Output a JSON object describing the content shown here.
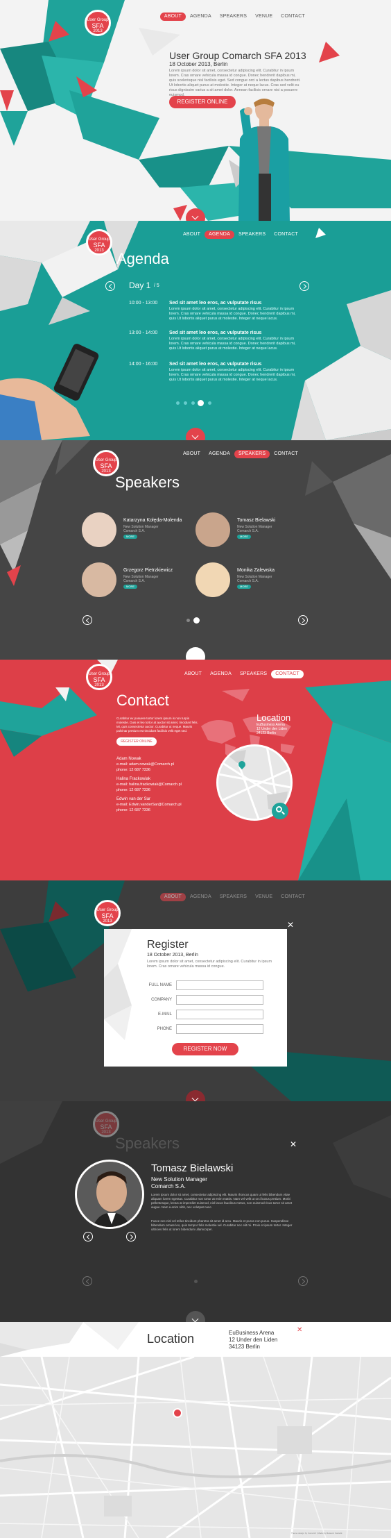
{
  "colors": {
    "red": "#e3434b",
    "teal": "#1fa39a",
    "dark": "#444444"
  },
  "logo": {
    "line1": "User Group",
    "line2": "SFA",
    "line3": "2013"
  },
  "hero": {
    "nav": [
      "ABOUT",
      "AGENDA",
      "SPEAKERS",
      "VENUE",
      "CONTACT"
    ],
    "title": "User Group Comarch SFA 2013",
    "subtitle": "18 October 2013, Berlin",
    "body": "Lorem ipsum dolor sit amet, consectetur adipiscing elit. Curabitur in ipsum lorem. Cras ornare vehicula massa id congue. Donec hendrerit dapibus mi, quis scelerisque nisl facilisis eget. Sed congue orci a lectus dapibus hendrerit. Ut lobortis aliquet purus at molestie. Integer at neque lacus. Cras sed velit eu risus dignissim varius a sit amet dolor. Aenean facilisis ornare nisi a posuere euismod.",
    "cta": "REGISTER ONLINE"
  },
  "agenda": {
    "nav": [
      "ABOUT",
      "AGENDA",
      "SPEAKERS",
      "CONTACT"
    ],
    "heading": "Agenda",
    "day": "Day 1",
    "day_total": "/ 5",
    "items": [
      {
        "time": "10:00 - 13:00",
        "title": "Sed sit amet leo eros, ac vulputate risus",
        "text": "Lorem ipsum dolor sit amet, consectetur adipiscing elit. Curabitur in ipsum lorem. Cras ornare vehicula massa id congue. Donec hendrerit dapibus mi, quis Ut lobortis aliquet purus at molestie. Integer at neque lacus."
      },
      {
        "time": "13:00 - 14:00",
        "title": "Sed sit amet leo eros, ac vulputate risus",
        "text": "Lorem ipsum dolor sit amet, consectetur adipiscing elit. Curabitur in ipsum lorem. Cras ornare vehicula massa id congue. Donec hendrerit dapibus mi, quis Ut lobortis aliquet purus at molestie. Integer at neque lacus."
      },
      {
        "time": "14:00 - 16:00",
        "title": "Sed sit amet leo eros, ac vulputate risus",
        "text": "Lorem ipsum dolor sit amet, consectetur adipiscing elit. Curabitur in ipsum lorem. Cras ornare vehicula massa id congue. Donec hendrerit dapibus mi, quis Ut lobortis aliquet purus at molestie. Integer at neque lacus."
      }
    ]
  },
  "speakers": {
    "nav": [
      "ABOUT",
      "AGENDA",
      "SPEAKERS",
      "CONTACT"
    ],
    "heading": "Speakers",
    "more": "MORE",
    "list": [
      {
        "name": "Katarzyna Kołęda-Molenda",
        "role": "New Solution Manager",
        "company": "Comarch S.A."
      },
      {
        "name": "Tomasz Bielawski",
        "role": "New Solution Manager",
        "company": "Comarch S.A."
      },
      {
        "name": "Grzegorz Pietrzkiewicz",
        "role": "New Solution Manager",
        "company": "Comarch S.A."
      },
      {
        "name": "Monika Zalewska",
        "role": "New Solution Manager",
        "company": "Comarch S.A."
      }
    ]
  },
  "contact": {
    "nav": [
      "ABOUT",
      "AGENDA",
      "SPEAKERS",
      "CONTACT"
    ],
    "heading": "Contact",
    "intro": "Curabitur ex posuere tortor lorem ipsum is non turpis molestie. Duis et leo tortor at auctor sit amet, tincidunt felis. Mi, quis consectetur auctor. Curabitur ut neque. Mauris pulvinar pretium est tincidunt facilisis velit eget sed.",
    "register_btn": "REGISTER ONLINE",
    "people": [
      {
        "name": "Adam Nowak",
        "email": "e-mail: adam.nowak@Comarch.pl",
        "phone": "phone: 12 687 7336"
      },
      {
        "name": "Halina Frackowiak",
        "email": "e-mail: halina.frackowiak@Comarch.pl",
        "phone": "phone: 12 687 7336"
      },
      {
        "name": "Edwin van der Sar",
        "email": "e-mail: Edwin.vanderSar@Comarch.pl",
        "phone": "phone: 12 687 7336"
      }
    ],
    "location_title": "Location",
    "location_lines": [
      "EuBusiness Arena",
      "12 Under den Liden",
      "34123 Berlin"
    ]
  },
  "register": {
    "nav": [
      "ABOUT",
      "AGENDA",
      "SPEAKERS",
      "VENUE",
      "CONTACT"
    ],
    "title": "Register",
    "date": "18 October 2013, Berlin",
    "text": "Lorem ipsum dolor sit amet, consectetur adipiscing elit. Curabitur in ipsum lorem. Cras ornare vehicula massa id congue.",
    "labels": [
      "FULL NAME",
      "COMPANY",
      "E-MAIL",
      "PHONE"
    ],
    "submit": "REGISTER NOW",
    "close": "✕"
  },
  "speaker_detail": {
    "heading": "Speakers",
    "name": "Tomasz Bielawski",
    "role": "New Solution Manager",
    "company": "Comarch S.A.",
    "bio1": "Lorem ipsum dolor sit amet, consectetur adipiscing elit. Mauris rhoncus quam ut felis bibendum vitae aliquam lorem egestas. Curabitur non tortor at enim mattis. Nam vel velit ut orci luctus pretium. Morbi pellentesque, lectus at imperdiet euismod, nisl lacus faucibus metus, non euismod risus tortor sit amet augue. Nam a enim nibh, nec volutpat nunc.",
    "bio2": "Fusce nec nisl vel tellus tincidunt pharetra sit amet id arcu. Mauris et purus non purus. Suspendisse bibendum ornare leo, quis tempor felis molestie vel. Curabitur nec elit mi. Proin et ipsum tortor. Integer ultricies felis ut lorem bibendum ullamcorper.",
    "close": "✕"
  },
  "location": {
    "title": "Location",
    "lines": [
      "EuBusiness Arena",
      "12 Under den Liden",
      "34123 Berlin"
    ],
    "close": "✕",
    "footer": "Theme design by Comarch | Made by Mateusz Kastelik"
  }
}
